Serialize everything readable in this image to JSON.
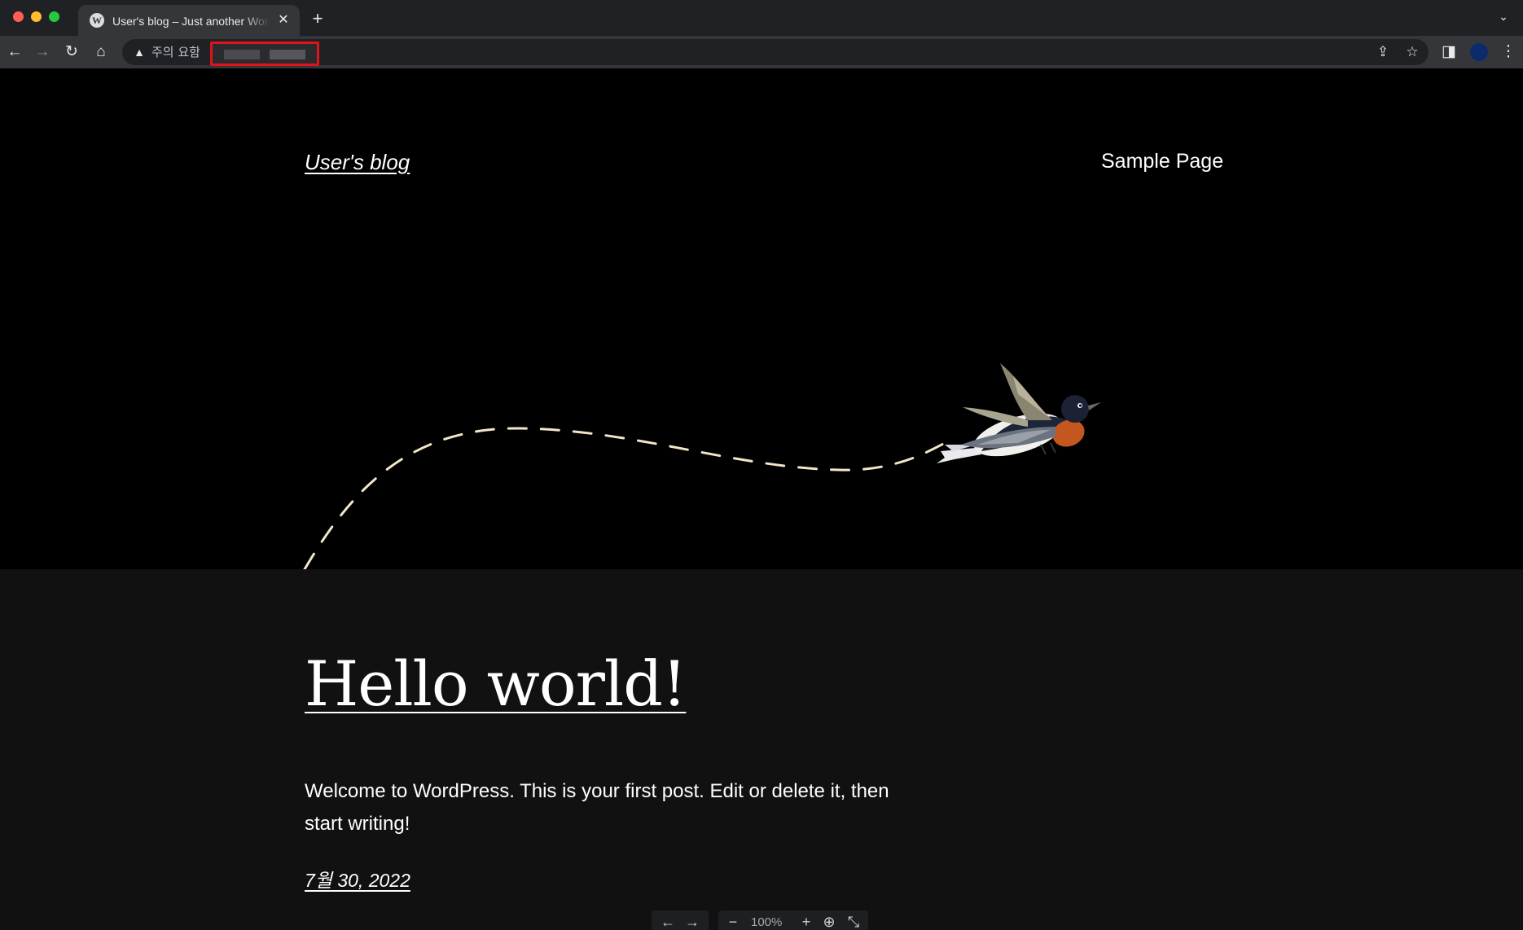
{
  "browser": {
    "tab": {
      "title": "User's blog – Just another WordPress site",
      "favicon": "wordpress-icon",
      "close_icon": "✕"
    },
    "new_tab_icon": "+",
    "tab_menu_icon": "⌄",
    "toolbar": {
      "back_icon": "←",
      "forward_icon": "→",
      "reload_icon": "↻",
      "home_icon": "⌂",
      "security_warning_icon": "▲",
      "security_label": "주의 요함",
      "share_icon": "⇪",
      "bookmark_icon": "☆",
      "sidepanel_icon": "◨",
      "menu_icon": "⋮"
    },
    "accent_highlight": "#e0121a"
  },
  "site": {
    "title": "User's blog",
    "nav": {
      "sample_page": "Sample Page"
    }
  },
  "post": {
    "title": "Hello world!",
    "excerpt": "Welcome to WordPress. This is your first post. Edit or delete it, then start writing!",
    "date": "7월 30, 2022"
  },
  "floating_toolbar": {
    "prev_icon": "←",
    "next_icon": "→",
    "zoom_out_icon": "−",
    "zoom_level": "100%",
    "zoom_in_icon": "+",
    "download_icon": "⊕",
    "collapse_icon": "⤡"
  },
  "colors": {
    "hero_background": "#000000",
    "page_background": "#111111",
    "text": "#ffffff",
    "dashed_path": "#f2e6c8"
  }
}
